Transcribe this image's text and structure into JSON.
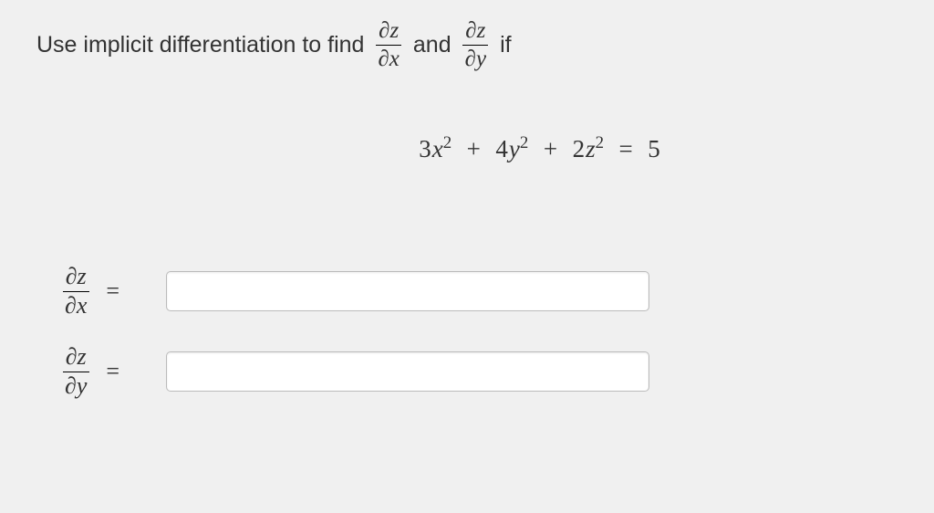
{
  "problem": {
    "lead": "Use implicit differentiation to find",
    "frac1_num": "∂z",
    "frac1_den": "∂x",
    "conj": "and",
    "frac2_num": "∂z",
    "frac2_den": "∂y",
    "tail": "if"
  },
  "equation": {
    "coef1": "3",
    "var1": "x",
    "pow1": "2",
    "op1": "+",
    "coef2": "4",
    "var2": "y",
    "pow2": "2",
    "op2": "+",
    "coef3": "2",
    "var3": "z",
    "pow3": "2",
    "eq": "=",
    "rhs": "5"
  },
  "answers": {
    "row1": {
      "num": "∂z",
      "den": "∂x",
      "eq": "=",
      "value": ""
    },
    "row2": {
      "num": "∂z",
      "den": "∂y",
      "eq": "=",
      "value": ""
    }
  },
  "chart_data": {
    "type": "table",
    "title": "Implicit differentiation problem",
    "equation": "3x^2 + 4y^2 + 2z^2 = 5",
    "unknowns": [
      "∂z/∂x",
      "∂z/∂y"
    ],
    "inputs": [
      {
        "label": "∂z/∂x",
        "value": ""
      },
      {
        "label": "∂z/∂y",
        "value": ""
      }
    ]
  }
}
